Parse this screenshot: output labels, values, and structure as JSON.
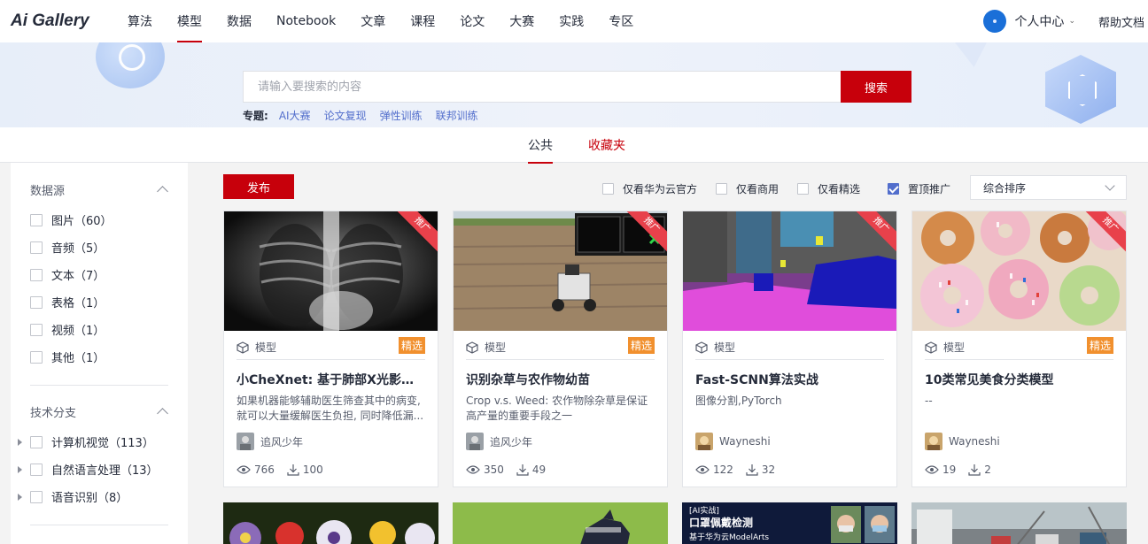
{
  "logo": "Ai Gallery",
  "nav": {
    "items": [
      "算法",
      "模型",
      "数据",
      "Notebook",
      "文章",
      "课程",
      "论文",
      "大赛",
      "实践",
      "专区"
    ],
    "active": "模型",
    "personal": "个人中心",
    "help": "帮助文档"
  },
  "search": {
    "placeholder": "请输入要搜索的内容",
    "button": "搜索"
  },
  "topics": {
    "label": "专题:",
    "items": [
      "AI大赛",
      "论文复现",
      "弹性训练",
      "联邦训练"
    ]
  },
  "tabs": {
    "public": "公共",
    "favorites": "收藏夹"
  },
  "sidebar": {
    "datasource": {
      "title": "数据源",
      "items": [
        "图片（60）",
        "音频（5）",
        "文本（7）",
        "表格（1）",
        "视频（1）",
        "其他（1）"
      ]
    },
    "tech": {
      "title": "技术分支",
      "items": [
        "计算机视觉（113）",
        "自然语言处理（13）",
        "语音识别（8）"
      ]
    }
  },
  "toolbar": {
    "publish": "发布",
    "filters": {
      "official": "仅看华为云官方",
      "commercial": "仅看商用",
      "featured": "仅看精选",
      "pinned": "置顶推广"
    },
    "sort": "综合排序"
  },
  "cards": [
    {
      "ribbon": "推广",
      "type": "模型",
      "badge": "精选",
      "title": "小CheXnet: 基于肺部X光影像...",
      "desc": "如果机器能够辅助医生筛查其中的病变, 就可以大量缓解医生负担, 同时降低漏...",
      "author": "追风少年",
      "views": "766",
      "downloads": "100"
    },
    {
      "ribbon": "推广",
      "type": "模型",
      "badge": "精选",
      "title": "识别杂草与农作物幼苗",
      "desc": "Crop v.s. Weed: 农作物除杂草是保证高产量的重要手段之一",
      "author": "追风少年",
      "views": "350",
      "downloads": "49"
    },
    {
      "ribbon": "推广",
      "type": "模型",
      "badge": "",
      "title": "Fast-SCNN算法实战",
      "desc": "图像分割,PyTorch",
      "author": "Wayneshi",
      "views": "122",
      "downloads": "32"
    },
    {
      "ribbon": "推广",
      "type": "模型",
      "badge": "精选",
      "title": "10类常见美食分类模型",
      "desc": "--",
      "author": "Wayneshi",
      "views": "19",
      "downloads": "2"
    }
  ],
  "row2": {
    "card3_text": "[AI实战]\n口罩佩戴检测\n基于华为云ModelArts\n开发AI模型"
  },
  "colors": {
    "accent": "#c7000b",
    "link": "#526ecc",
    "badge": "#f1902e",
    "ribbon": "#e8414b"
  }
}
